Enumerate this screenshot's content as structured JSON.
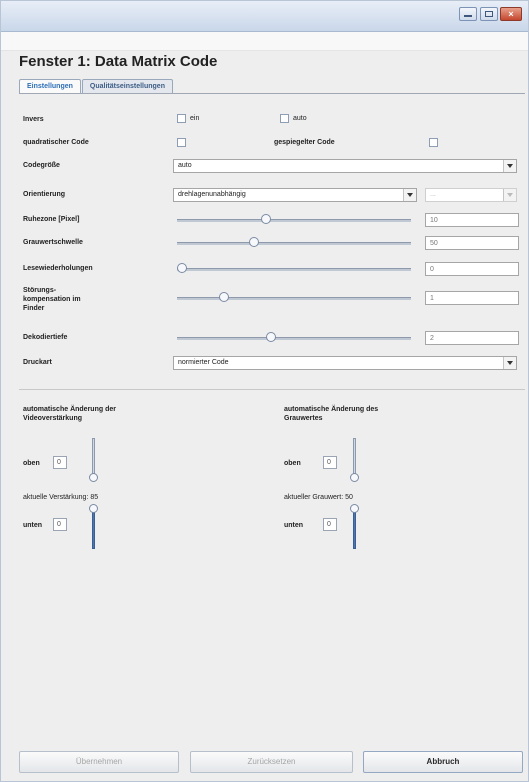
{
  "title": "Fenster 1: Data Matrix Code",
  "tabs": [
    "Einstellungen",
    "Qualitätseinstellungen"
  ],
  "rows": {
    "invers": {
      "label": "Invers",
      "cb1": "ein",
      "cb2": "auto"
    },
    "quadratisch": {
      "label": "quadratischer Code",
      "label2": "gespiegelter Code"
    },
    "codegroesse": {
      "label": "Codegröße",
      "value": "auto"
    },
    "orientierung": {
      "label": "Orientierung",
      "value": "drehlagenunabhängig",
      "value2": "..."
    },
    "ruhezone": {
      "label": "Ruhezone [Pixel]",
      "value": "10",
      "level": 0.38
    },
    "grauwert": {
      "label": "Grauwertschwelle",
      "value": "50",
      "level": 0.33
    },
    "lesewiederholungen": {
      "label": "Lesewiederholungen",
      "value": "0",
      "level": 0.0
    },
    "stoerung": {
      "label1": "Störungs-",
      "label2": "kompensation im",
      "label3": "Finder",
      "value": "1",
      "level": 0.2
    },
    "dekodiertiefe": {
      "label": "Dekodiertiefe",
      "value": "2",
      "level": 0.4
    },
    "druckart": {
      "label": "Druckart",
      "value": "normierter Code"
    }
  },
  "video": {
    "title1": "automatische Änderung der",
    "title2": "Videoverstärkung",
    "oben_label": "oben",
    "oben_value": "0",
    "status": "aktuelle Verstärkung: 85",
    "unten_label": "unten",
    "unten_value": "0"
  },
  "gray": {
    "title1": "automatische Änderung des",
    "title2": "Grauwertes",
    "oben_label": "oben",
    "oben_value": "0",
    "status": "aktueller Grauwert: 50",
    "unten_label": "unten",
    "unten_value": "0"
  },
  "buttons": {
    "apply": "Übernehmen",
    "reset": "Zurücksetzen",
    "cancel": "Abbruch"
  }
}
